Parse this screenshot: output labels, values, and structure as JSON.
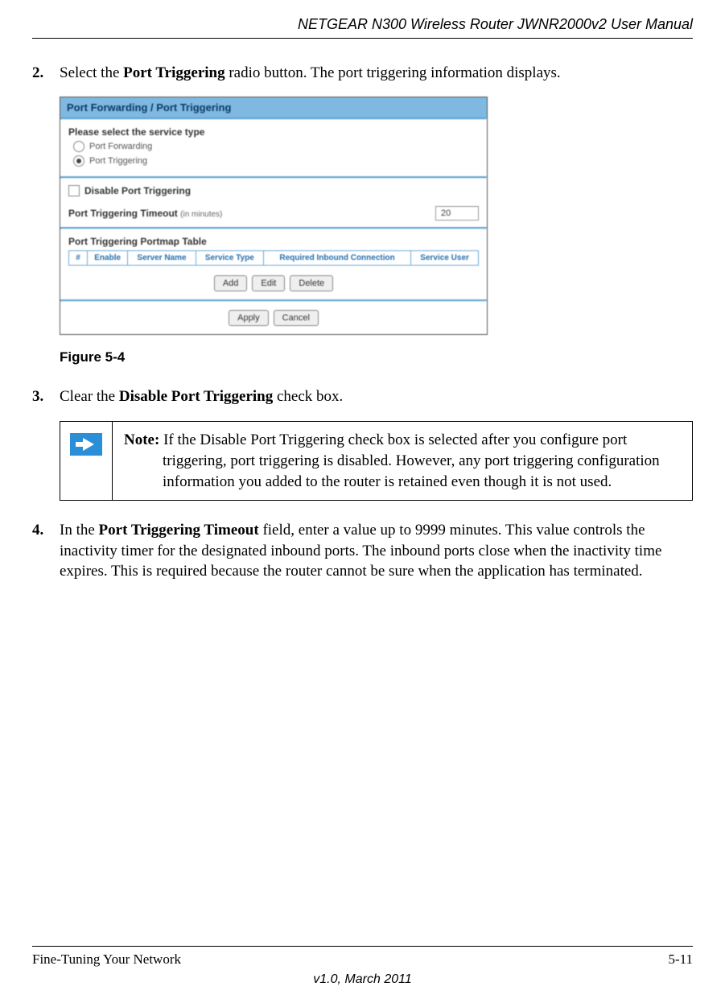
{
  "header": {
    "title": "NETGEAR N300 Wireless Router JWNR2000v2 User Manual"
  },
  "steps": {
    "s2": {
      "num": "2.",
      "pre": "Select the ",
      "bold": "Port Triggering",
      "post": " radio button. The port triggering information displays."
    },
    "s3": {
      "num": "3.",
      "pre": "Clear the ",
      "bold": "Disable Port Triggering",
      "post": " check box."
    },
    "s4": {
      "num": "4.",
      "pre": "In the ",
      "bold": "Port Triggering Timeout",
      "post": " field, enter a value up to 9999 minutes. This value controls the inactivity timer for the designated inbound ports. The inbound ports close when the inactivity time expires. This is required because the router cannot be sure when the application has terminated."
    }
  },
  "figure": {
    "panel_title": "Port Forwarding / Port Triggering",
    "select_label": "Please select the service type",
    "radio_forwarding": "Port Forwarding",
    "radio_triggering": "Port Triggering",
    "disable_checkbox": "Disable Port Triggering",
    "timeout_label": "Port Triggering Timeout",
    "timeout_units": "(in minutes)",
    "timeout_value": "20",
    "portmap_label": "Port Triggering Portmap Table",
    "th_num": "#",
    "th_enable": "Enable",
    "th_server": "Server Name",
    "th_service_type": "Service Type",
    "th_inbound": "Required Inbound Connection",
    "th_service_user": "Service User",
    "btn_add": "Add",
    "btn_edit": "Edit",
    "btn_delete": "Delete",
    "btn_apply": "Apply",
    "btn_cancel": "Cancel",
    "caption": "Figure 5-4"
  },
  "note": {
    "lead": "Note:",
    "body": " If the Disable Port Triggering check box is selected after you configure port triggering, port triggering is disabled. However, any port triggering configuration information you added to the router is retained even though it is not used."
  },
  "footer": {
    "left": "Fine-Tuning Your Network",
    "right": "5-11",
    "bottom": "v1.0, March 2011"
  }
}
